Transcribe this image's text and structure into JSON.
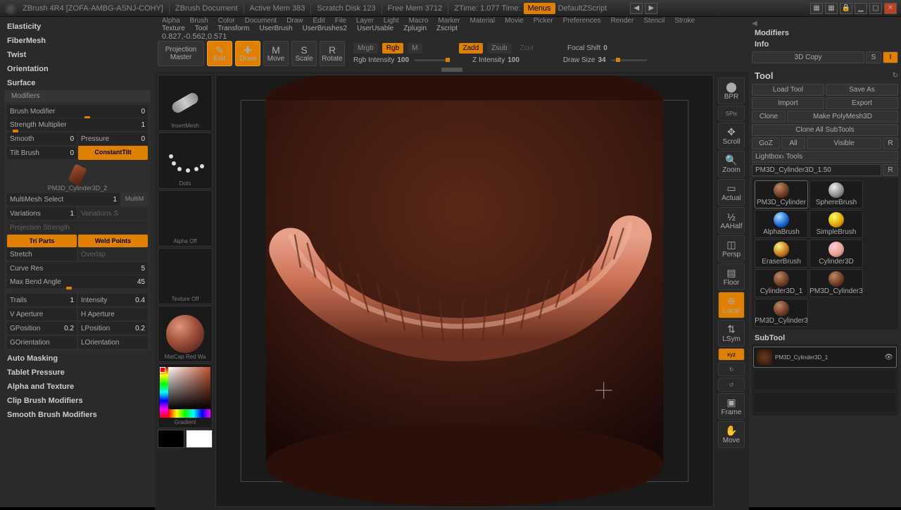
{
  "titlebar": {
    "app": "ZBrush 4R4 [ZOFA-AMBG-ASNJ-COHY]",
    "doc": "ZBrush Document",
    "mem": "Active Mem 383",
    "scratch": "Scratch Disk 123",
    "free": "Free Mem 3712",
    "ztime": "ZTime: 1.077 Time:",
    "menus": "Menus",
    "script": "DefaultZScript"
  },
  "menus": [
    "Alpha",
    "Brush",
    "Color",
    "Document",
    "Draw",
    "Edit",
    "File",
    "Layer",
    "Light",
    "Macro",
    "Marker",
    "Material",
    "Movie",
    "Picker",
    "Preferences",
    "Render",
    "Stencil",
    "Stroke"
  ],
  "menus2": [
    "Texture",
    "Tool",
    "Transform",
    "UserBrush",
    "UserBrushes2",
    "UserUsable",
    "Zplugin",
    "Zscript"
  ],
  "status": "0.827,-0.562,0.571",
  "toolbar": {
    "projection": "Projection Master",
    "edit": "Edit",
    "draw": "Draw",
    "move": "Move",
    "scale": "Scale",
    "rotate": "Rotate",
    "mrgb": "Mrgb",
    "rgb": "Rgb",
    "m": "M",
    "rgbint": "Rgb Intensity",
    "rgbint_v": "100",
    "zadd": "Zadd",
    "zsub": "Zsub",
    "zcut": "Zcut",
    "zint": "Z Intensity",
    "zint_v": "100",
    "focal": "Focal Shift",
    "focal_v": "0",
    "drawsize": "Draw Size",
    "drawsize_v": "34"
  },
  "left": {
    "items": [
      "Elasticity",
      "FiberMesh",
      "Twist",
      "Orientation",
      "Surface"
    ],
    "mod_hdr": "Modifiers",
    "brush_mod": "Brush Modifier",
    "brush_mod_v": "0",
    "strength": "Strength Multiplier",
    "strength_v": "1",
    "smooth": "Smooth",
    "smooth_v": "0",
    "pressure": "Pressure",
    "pressure_v": "0",
    "tilt": "Tilt Brush",
    "tilt_v": "0",
    "constant": "ConstantTilt",
    "pm3d": "PM3D_Cylinder3D_2",
    "multimesh": "MultiMesh Select",
    "multimesh_v": "1",
    "multim": "MultiM",
    "variations": "Variations",
    "variations_v": "1",
    "var_s": "Variations S",
    "proj": "Projection Strength",
    "tri": "Tri Parts",
    "weld": "Weld Points",
    "stretch": "Stretch",
    "overlap": "Overlap",
    "curve": "Curve Res",
    "curve_v": "5",
    "maxbend": "Max Bend Angle",
    "maxbend_v": "45",
    "trails": "Trails",
    "trails_v": "1",
    "intensity": "Intensity",
    "intensity_v": "0.4",
    "vap": "V Aperture",
    "hap": "H Aperture",
    "gpos": "GPosition",
    "gpos_v": "0.2",
    "lpos": "LPosition",
    "lpos_v": "0.2",
    "gor": "GOrientation",
    "lor": "LOrientation",
    "auto": "Auto Masking",
    "tablet": "Tablet Pressure",
    "alpha": "Alpha and Texture",
    "clip": "Clip Brush Modifiers",
    "smoothb": "Smooth Brush Modifiers"
  },
  "thumbs": {
    "insert": "InsertMesh",
    "dots": "Dots",
    "alpha": "Alpha Off",
    "texture": "Texture Off",
    "matcap": "MatCap Red Wa",
    "gradient": "Gradient"
  },
  "view": {
    "bpr": "BPR",
    "spix": "SPix",
    "scroll": "Scroll",
    "zoom": "Zoom",
    "actual": "Actual",
    "aahalf": "AAHalf",
    "persp": "Persp",
    "floor": "Floor",
    "local": "Local",
    "lsym": "LSym",
    "xyz": "xyz",
    "frame": "Frame",
    "move": "Move"
  },
  "right": {
    "modifiers": "Modifiers",
    "info": "Info",
    "copy3d": "3D Copy",
    "s": "S",
    "i": "I",
    "tool": "Tool",
    "load": "Load Tool",
    "save": "Save As",
    "import": "Import",
    "export": "Export",
    "clone": "Clone",
    "makepoly": "Make PolyMesh3D",
    "cloneall": "Clone All SubTools",
    "goz": "GoZ",
    "all": "All",
    "visible": "Visible",
    "r": "R",
    "lightbox": "Lightbox› Tools",
    "current": "PM3D_Cylinder3D_1.50",
    "rbtn": "R",
    "tools": [
      "PM3D_Cylinder",
      "SphereBrush",
      "AlphaBrush",
      "SimpleBrush",
      "EraserBrush",
      "Cylinder3D",
      "Cylinder3D_1",
      "PM3D_Cylinder3",
      "PM3D_Cylinder3"
    ],
    "subtool": "SubTool",
    "st1": "PM3D_Cylinder3D_1"
  }
}
